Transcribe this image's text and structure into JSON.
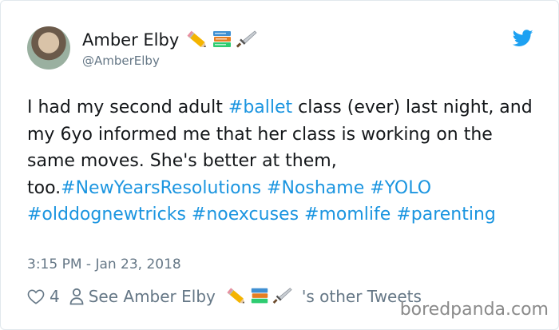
{
  "author": {
    "display_name": "Amber Elby",
    "handle": "@AmberElby",
    "name_emojis": [
      "pencil-icon",
      "books-icon",
      "dagger-icon"
    ]
  },
  "tweet": {
    "segments": [
      {
        "text": "I had my second adult ",
        "hashtag": false
      },
      {
        "text": "#ballet",
        "hashtag": true
      },
      {
        "text": " class (ever) last night, and my 6yo informed me that her class is working on the same moves. She's better at them, too.",
        "hashtag": false
      },
      {
        "text": "#NewYearsResolutions",
        "hashtag": true
      },
      {
        "text": " ",
        "hashtag": false
      },
      {
        "text": "#Noshame",
        "hashtag": true
      },
      {
        "text": " ",
        "hashtag": false
      },
      {
        "text": "#YOLO",
        "hashtag": true
      },
      {
        "text": " ",
        "hashtag": false
      },
      {
        "text": "#olddognewtricks",
        "hashtag": true
      },
      {
        "text": " ",
        "hashtag": false
      },
      {
        "text": "#noexcuses",
        "hashtag": true
      },
      {
        "text": " ",
        "hashtag": false
      },
      {
        "text": "#momlife",
        "hashtag": true
      },
      {
        "text": " ",
        "hashtag": false
      },
      {
        "text": "#parenting",
        "hashtag": true
      }
    ],
    "timestamp": "3:15 PM - Jan 23, 2018"
  },
  "actions": {
    "like_count": "4",
    "see_prefix": "See Amber Elby",
    "see_suffix": "'s other Tweets"
  },
  "watermark": "boredpanda.com",
  "colors": {
    "hashtag": "#1b95e0",
    "twitter_blue": "#1da1f2",
    "muted": "#657786"
  }
}
